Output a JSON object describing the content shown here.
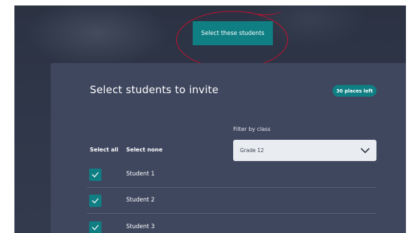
{
  "header": {
    "cta_label": "Select these students"
  },
  "panel": {
    "title": "Select students to invite",
    "badge": "30 places left",
    "filter": {
      "label": "Filter by class",
      "selected": "Grade 12"
    },
    "select_all_label": "Select all",
    "select_none_label": "Select none",
    "students": [
      {
        "name": "Student 1",
        "checked": true
      },
      {
        "name": "Student 2",
        "checked": true
      },
      {
        "name": "Student 3",
        "checked": true
      }
    ]
  },
  "colors": {
    "accent": "#0f7f84",
    "panel": "#3f475f",
    "background": "#2f3648",
    "annotation": "#c8102e"
  }
}
